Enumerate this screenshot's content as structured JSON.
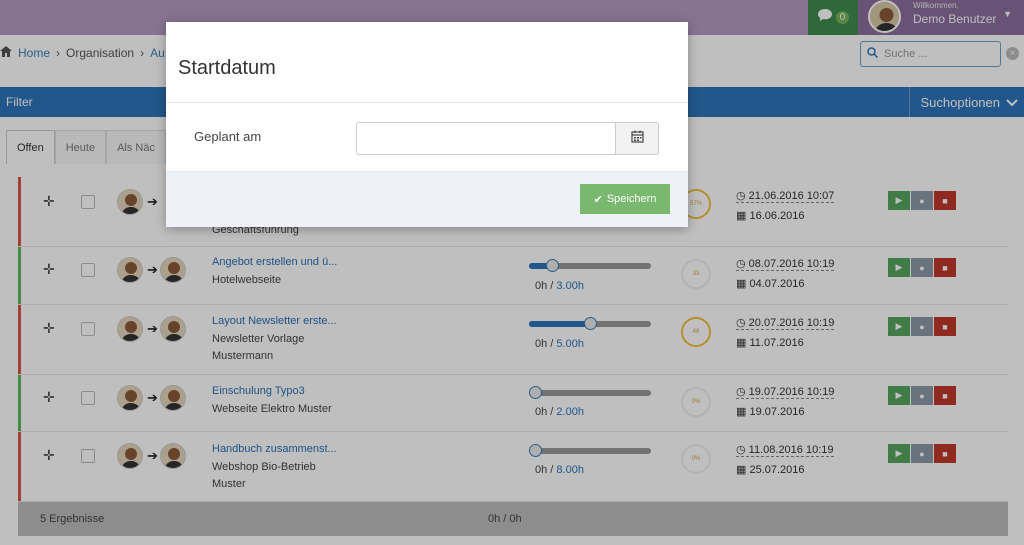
{
  "header": {
    "chat_count": "0",
    "welcome": "Willkommen,",
    "username": "Demo Benutzer"
  },
  "breadcrumb": {
    "home": "Home",
    "organisation": "Organisation",
    "current": "Au"
  },
  "search": {
    "placeholder": "Suche ..."
  },
  "filter": {
    "label": "Filter",
    "options": "Suchoptionen"
  },
  "tabs": [
    {
      "label": "Offen"
    },
    {
      "label": "Heute"
    },
    {
      "label": "Als Näc"
    }
  ],
  "tasks": [
    {
      "title": "",
      "subtitle": "Geschäftsführung",
      "progress": 0,
      "hours_spent": "",
      "hours_planned": "",
      "percent": "57%",
      "deadline": "21.06.2016 10:07",
      "start": "16.06.2016",
      "status": "red"
    },
    {
      "title": "Angebot erstellen und ü...",
      "subtitle": "Hotelwebseite",
      "progress": 0.19,
      "hours_spent": "0h",
      "hours_planned": "3.00h",
      "percent": "33",
      "deadline": "08.07.2016 10:19",
      "start": "04.07.2016",
      "status": "green"
    },
    {
      "title": "Layout Newsletter erste...",
      "subtitle": "Newsletter Vorlage",
      "subtitle2": "Mustermann",
      "progress": 0.5,
      "hours_spent": "0h",
      "hours_planned": "5.00h",
      "percent": "48",
      "deadline": "20.07.2016 10:19",
      "start": "11.07.2016",
      "status": "red"
    },
    {
      "title": "Einschulung Typo3",
      "subtitle": "Webseite Elektro Muster",
      "progress": 0,
      "hours_spent": "0h",
      "hours_planned": "2.00h",
      "percent": "0%",
      "deadline": "19.07.2016 10:19",
      "start": "19.07.2016",
      "status": "green"
    },
    {
      "title": "Handbuch zusammenst...",
      "subtitle": "Webshop Bio-Betrieb",
      "subtitle2": "Muster",
      "progress": 0,
      "hours_spent": "0h",
      "hours_planned": "8.00h",
      "percent": "0%",
      "deadline": "11.08.2016 10:19",
      "start": "25.07.2016",
      "status": "red"
    }
  ],
  "footer": {
    "results": "5 Ergebnisse",
    "total": "0h / 0h"
  },
  "modal": {
    "title": "Startdatum",
    "field_label": "Geplant am",
    "field_value": "",
    "save_label": "Speichern"
  },
  "colors": {
    "red": "#d9534f",
    "green": "#5cb85c"
  }
}
